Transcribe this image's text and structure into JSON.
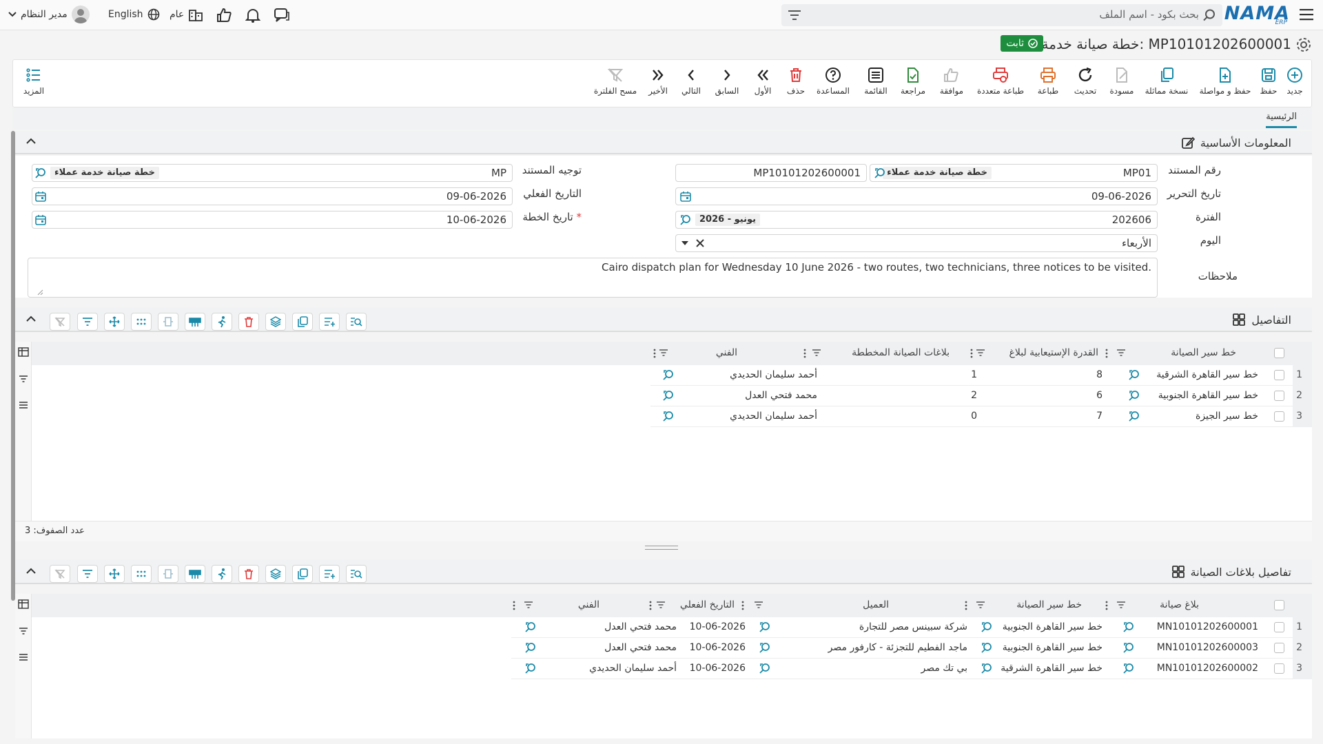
{
  "header": {
    "search_placeholder": "بحث بكود - اسم الملف",
    "logo_text": "NAMA",
    "logo_sub": "ERP",
    "user_name": "مدير النظام",
    "language": "English",
    "scope": "عام"
  },
  "title": {
    "text": "خطة صيانة خدمة عملاء: MP10101202600001",
    "status": "ثابت"
  },
  "toolbar": {
    "new": "جديد",
    "save": "حفظ",
    "save_continue": "حفظ و مواصلة",
    "duplicate": "نسخة مماثلة",
    "draft": "مسودة",
    "refresh": "تحديث",
    "print": "طباعة",
    "multi_print": "طباعة متعددة",
    "approve": "موافقة",
    "review": "مراجعة",
    "list": "القائمة",
    "help": "المساعدة",
    "delete": "حذف",
    "first": "الأول",
    "previous": "السابق",
    "next": "التالي",
    "last": "الأخير",
    "clear_filter": "مسح الفلترة",
    "more": "المزيد"
  },
  "tabs": {
    "main": "الرئيسية"
  },
  "basic": {
    "section_title": "المعلومات الأساسية",
    "doc_number_label": "رقم المستند",
    "doc_code": "MP01",
    "doc_type_chip": "خطة صيانة خدمة عملاء",
    "doc_number": "MP10101202600001",
    "doc_direction_label": "توجيه المستند",
    "doc_direction_value": "MP",
    "doc_direction_chip": "خطة صيانة خدمة عملاء",
    "edit_date_label": "تاريخ التحرير",
    "edit_date": "09-06-2026",
    "actual_date_label": "التاريخ الفعلي",
    "actual_date": "09-06-2026",
    "period_label": "الفترة",
    "period_value": "202606",
    "period_chip": "2026 - يونيو",
    "plan_date_label": "تاريخ الخطة",
    "plan_date_required": "*",
    "plan_date": "10-06-2026",
    "day_label": "اليوم",
    "day_value": "الأربعاء",
    "notes_label": "ملاحظات",
    "notes_value": "Cairo dispatch plan for Wednesday 10 June 2026 - two routes, two technicians, three notices to be visited."
  },
  "details": {
    "section_title": "التفاصيل",
    "columns": {
      "route": "خط سير الصيانة",
      "capacity": "القدرة الإستيعابية لبلاغ",
      "planned": "بلاغات الصيانة المخططة",
      "technician": "الفني"
    },
    "rows": [
      {
        "num": "1",
        "route": "خط سير القاهرة الشرقية",
        "capacity": "8",
        "planned": "1",
        "technician": "أحمد سليمان الحديدي"
      },
      {
        "num": "2",
        "route": "خط سير القاهرة الجنوبية",
        "capacity": "6",
        "planned": "2",
        "technician": "محمد فتحي العدل"
      },
      {
        "num": "3",
        "route": "خط سير الجيزة",
        "capacity": "7",
        "planned": "0",
        "technician": "أحمد سليمان الحديدي"
      }
    ],
    "row_count": "عدد الصفوف: 3"
  },
  "notices": {
    "section_title": "تفاصيل بلاغات الصيانة",
    "columns": {
      "notice": "بلاغ صيانة",
      "route": "خط سير الصيانة",
      "customer": "العميل",
      "actual_date": "التاريخ الفعلي",
      "technician": "الفني"
    },
    "rows": [
      {
        "num": "1",
        "notice": "MN10101202600001",
        "route": "خط سير القاهرة الجنوبية",
        "customer": "شركة سبينس مصر للتجارة",
        "actual_date": "10-06-2026",
        "technician": "محمد فتحي العدل"
      },
      {
        "num": "2",
        "notice": "MN10101202600003",
        "route": "خط سير القاهرة الجنوبية",
        "customer": "ماجد الفطيم للتجزئة - كارفور مصر",
        "actual_date": "10-06-2026",
        "technician": "محمد فتحي العدل"
      },
      {
        "num": "3",
        "notice": "MN10101202600002",
        "route": "خط سير القاهرة الشرقية",
        "customer": "بي تك مصر",
        "actual_date": "10-06-2026",
        "technician": "أحمد سليمان الحديدي"
      }
    ]
  },
  "colors": {
    "accent": "#1b8aa8",
    "danger": "#e03b3b",
    "success": "#1e8e3e",
    "logo": "#1b6fb0"
  }
}
